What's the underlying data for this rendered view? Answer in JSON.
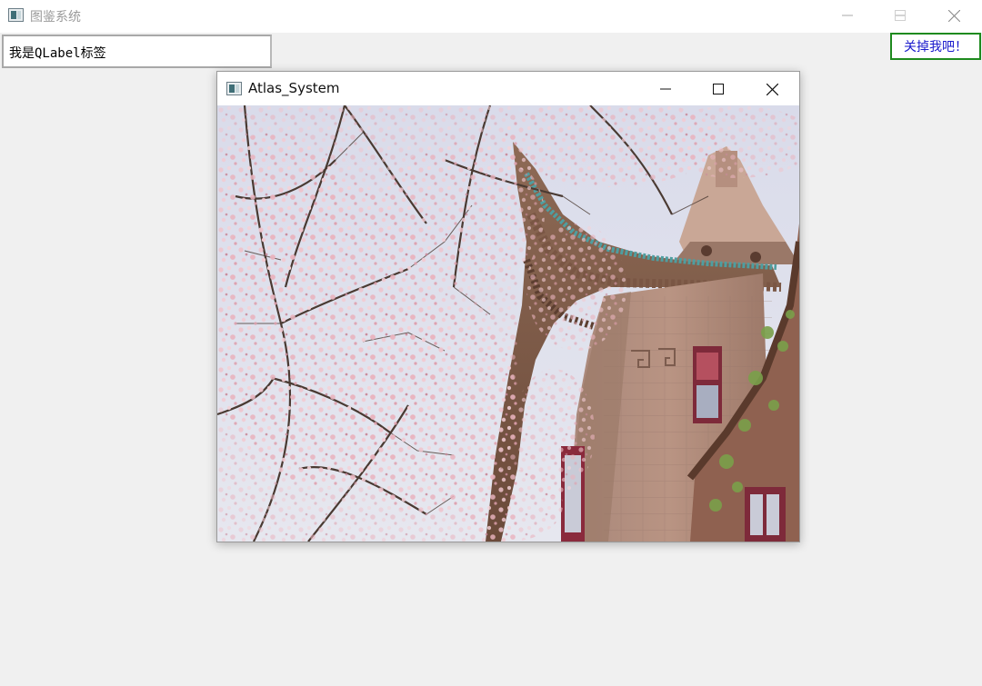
{
  "main_window": {
    "title": "图鉴系统",
    "icon": "app-window-icon",
    "controls": [
      "minimize-icon",
      "maximize-icon",
      "close-icon"
    ]
  },
  "qlabel": {
    "text": "我是QLabel标签"
  },
  "close_button": {
    "label": "关掉我吧！",
    "border_color": "#1e8a1e",
    "text_color": "#1a1acc"
  },
  "child_window": {
    "title": "Atlas_System",
    "icon": "app-window-icon",
    "controls": [
      "minimize-icon",
      "maximize-icon",
      "close-icon"
    ],
    "image": {
      "subject": "cherry blossoms and traditional pavilion building"
    }
  }
}
